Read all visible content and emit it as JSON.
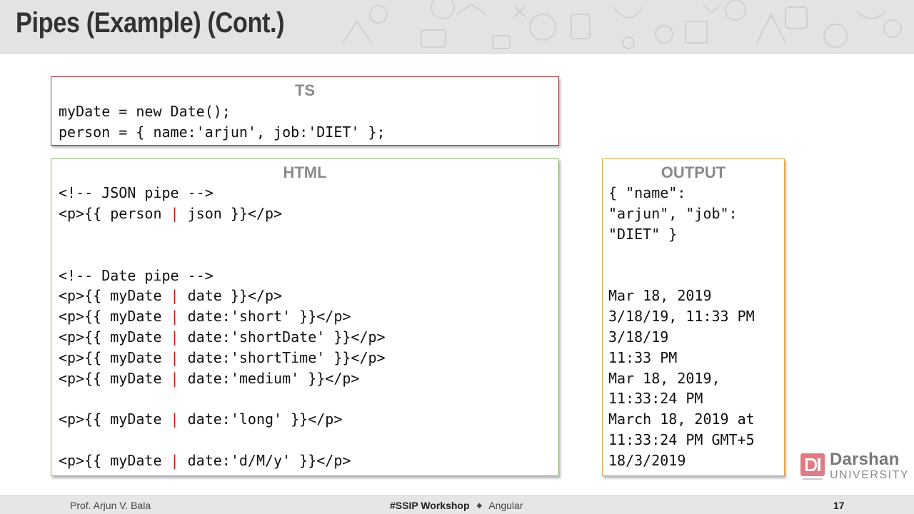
{
  "slide": {
    "title": "Pipes (Example) (Cont.)"
  },
  "ts_box": {
    "label": "TS",
    "lines": [
      "myDate = new Date();",
      "person = { name:'arjun', job:'DIET' };"
    ]
  },
  "html_box": {
    "label": "HTML",
    "json_comment": "<!-- JSON pipe -->",
    "json_line": {
      "before": "<p>{{ person ",
      "pipe": "|",
      "after": " json }}</p>"
    },
    "date_comment": "<!-- Date pipe -->",
    "date_lines": [
      {
        "before": "<p>{{ myDate ",
        "pipe": "|",
        "after": " date }}</p>"
      },
      {
        "before": "<p>{{ myDate ",
        "pipe": "|",
        "after": " date:'short' }}</p>"
      },
      {
        "before": "<p>{{ myDate ",
        "pipe": "|",
        "after": " date:'shortDate' }}</p>"
      },
      {
        "before": "<p>{{ myDate ",
        "pipe": "|",
        "after": " date:'shortTime' }}</p>"
      },
      {
        "before": "<p>{{ myDate ",
        "pipe": "|",
        "after": " date:'medium' }}</p>"
      },
      {
        "before": "<p>{{ myDate ",
        "pipe": "|",
        "after": " date:'long' }}</p>"
      },
      {
        "before": "<p>{{ myDate ",
        "pipe": "|",
        "after": " date:'d/M/y' }}</p>"
      }
    ]
  },
  "output_box": {
    "label": "OUTPUT",
    "lines": [
      "{ \"name\":",
      "\"arjun\", \"job\":",
      "\"DIET\" }",
      "Mar 18, 2019",
      "3/18/19, 11:33 PM",
      "3/18/19",
      "11:33 PM",
      "Mar 18, 2019,",
      "11:33:24 PM",
      "March 18, 2019 at",
      "11:33:24 PM GMT+5",
      "18/3/2019"
    ]
  },
  "logo": {
    "name": "Darshan",
    "subtitle": "UNIVERSITY",
    "color": "#e07b85"
  },
  "footer": {
    "author": "Prof. Arjun V. Bala",
    "event": "#SSIP Workshop",
    "separator": "◆",
    "topic": "Angular",
    "page": "17"
  },
  "colors": {
    "pipe_accent": "#d31c1c",
    "ts_border": "#a5323a",
    "html_border": "#8db26a",
    "output_border": "#e3a53c"
  }
}
